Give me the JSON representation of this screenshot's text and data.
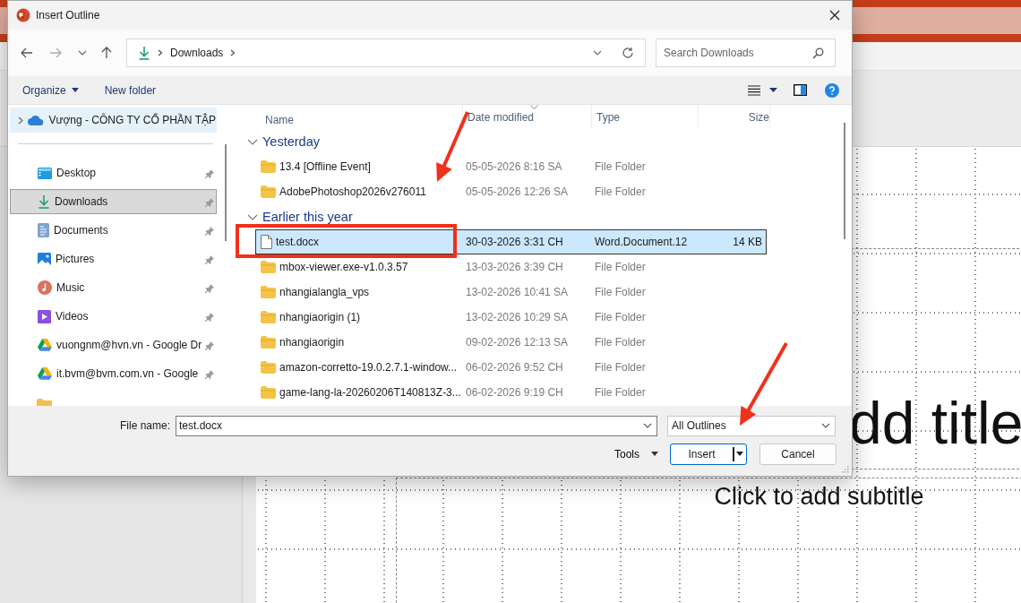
{
  "app": {
    "title_placeholder": "dd title",
    "subtitle_placeholder": "Click to add subtitle"
  },
  "window": {
    "title": "Insert Outline"
  },
  "address": {
    "segments": [
      "Downloads"
    ]
  },
  "search": {
    "placeholder": "Search Downloads"
  },
  "toolbar": {
    "organize": "Organize",
    "new_folder": "New folder"
  },
  "nav_pane": {
    "items": [
      {
        "label": "Vượng - CÔNG TY CỔ PHẦN TẬP",
        "kind": "cloud",
        "selected": false,
        "hovered": true,
        "pinned": false,
        "expandable": true
      },
      {
        "label": "Desktop",
        "kind": "desktop",
        "selected": false,
        "hovered": false,
        "pinned": true,
        "expandable": false
      },
      {
        "label": "Downloads",
        "kind": "downloads",
        "selected": true,
        "hovered": false,
        "pinned": true,
        "expandable": false
      },
      {
        "label": "Documents",
        "kind": "documents",
        "selected": false,
        "hovered": false,
        "pinned": true,
        "expandable": false
      },
      {
        "label": "Pictures",
        "kind": "pictures",
        "selected": false,
        "hovered": false,
        "pinned": true,
        "expandable": false
      },
      {
        "label": "Music",
        "kind": "music",
        "selected": false,
        "hovered": false,
        "pinned": true,
        "expandable": false
      },
      {
        "label": "Videos",
        "kind": "videos",
        "selected": false,
        "hovered": false,
        "pinned": true,
        "expandable": false
      },
      {
        "label": "vuongnm@hvn.vn - Google Dr",
        "kind": "drive",
        "selected": false,
        "hovered": false,
        "pinned": true,
        "expandable": false
      },
      {
        "label": "it.bvm@bvm.com.vn - Google",
        "kind": "drive",
        "selected": false,
        "hovered": false,
        "pinned": true,
        "expandable": false
      }
    ]
  },
  "columns": [
    {
      "label": "Name",
      "sorted": false
    },
    {
      "label": "Date modified",
      "sorted": true
    },
    {
      "label": "Type",
      "sorted": false
    },
    {
      "label": "Size",
      "sorted": false
    }
  ],
  "groups": [
    {
      "label": "Yesterday",
      "expanded": true,
      "files": [
        {
          "name": "13.4 [Offline Event]",
          "date": "05-05-2026 8:16 SA",
          "type": "File Folder",
          "kind": "folder",
          "selected": false
        },
        {
          "name": "AdobePhotoshop2026v276011",
          "date": "05-05-2026 12:26 SA",
          "type": "File Folder",
          "kind": "folder",
          "selected": false
        }
      ]
    },
    {
      "label": "Earlier this year",
      "expanded": true,
      "files": [
        {
          "name": "test.docx",
          "date": "30-03-2026 3:31 CH",
          "type": "Word.Document.12",
          "size": "14 KB",
          "kind": "document",
          "selected": true
        },
        {
          "name": "mbox-viewer.exe-v1.0.3.57",
          "date": "13-03-2026 3:39 CH",
          "type": "File Folder",
          "kind": "folder",
          "selected": false
        },
        {
          "name": "nhangialangla_vps",
          "date": "13-02-2026 10:41 SA",
          "type": "File Folder",
          "kind": "folder",
          "selected": false
        },
        {
          "name": "nhangiaorigin (1)",
          "date": "13-02-2026 10:29 SA",
          "type": "File Folder",
          "kind": "folder",
          "selected": false
        },
        {
          "name": "nhangiaorigin",
          "date": "09-02-2026 12:13 SA",
          "type": "File Folder",
          "kind": "folder",
          "selected": false
        },
        {
          "name": "amazon-corretto-19.0.2.7.1-window...",
          "date": "06-02-2026 9:52 CH",
          "type": "File Folder",
          "kind": "folder",
          "selected": false
        },
        {
          "name": "game-lang-la-20260206T140813Z-3...",
          "date": "06-02-2026 9:19 CH",
          "type": "File Folder",
          "kind": "folder",
          "selected": false
        }
      ]
    }
  ],
  "file_name": {
    "label": "File name:",
    "value": "test.docx"
  },
  "file_type": {
    "value": "All Outlines"
  },
  "tools": {
    "label": "Tools"
  },
  "buttons": [
    {
      "label": "Insert",
      "kind": "split"
    },
    {
      "label": "Cancel",
      "kind": "plain"
    }
  ],
  "annotations": [
    {
      "kind": "arrow"
    },
    {
      "kind": "box"
    },
    {
      "kind": "arrow"
    }
  ]
}
